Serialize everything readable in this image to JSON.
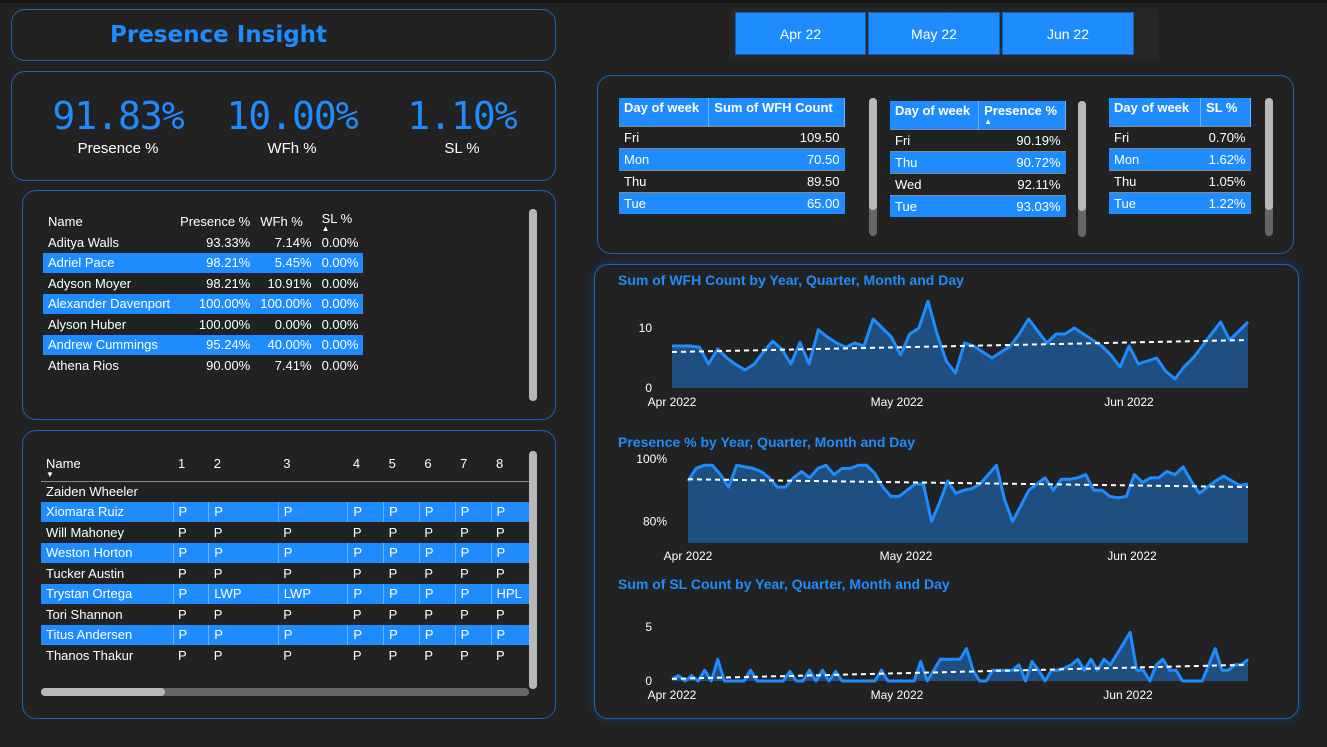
{
  "title": "Presence Insight",
  "slicers": [
    "Apr 22",
    "May 22",
    "Jun 22"
  ],
  "kpis": [
    {
      "value": "91.83%",
      "label": "Presence %"
    },
    {
      "value": "10.00%",
      "label": "WFh %"
    },
    {
      "value": "1.10%",
      "label": "SL %"
    }
  ],
  "summary_table": {
    "headers": [
      "Name",
      "Presence %",
      "WFh %",
      "SL %"
    ],
    "rows": [
      [
        "Aditya Walls",
        "93.33%",
        "7.14%",
        "0.00%"
      ],
      [
        "Adriel Pace",
        "98.21%",
        "5.45%",
        "0.00%"
      ],
      [
        "Adyson Moyer",
        "98.21%",
        "10.91%",
        "0.00%"
      ],
      [
        "Alexander Davenport",
        "100.00%",
        "100.00%",
        "0.00%"
      ],
      [
        "Alyson Huber",
        "100.00%",
        "0.00%",
        "0.00%"
      ],
      [
        "Andrew Cummings",
        "95.24%",
        "40.00%",
        "0.00%"
      ],
      [
        "Athena Rios",
        "90.00%",
        "7.41%",
        "0.00%"
      ]
    ]
  },
  "daily_table": {
    "headers": [
      "Name",
      "1",
      "2",
      "3",
      "4",
      "5",
      "6",
      "7",
      "8"
    ],
    "rows": [
      [
        "Zaiden Wheeler",
        "",
        "",
        "",
        "",
        "",
        "",
        "",
        ""
      ],
      [
        "Xiomara Ruiz",
        "P",
        "P",
        "P",
        "P",
        "P",
        "P",
        "P",
        "P"
      ],
      [
        "Will Mahoney",
        "P",
        "P",
        "P",
        "P",
        "P",
        "P",
        "P",
        "P"
      ],
      [
        "Weston Horton",
        "P",
        "P",
        "P",
        "P",
        "P",
        "P",
        "P",
        "P"
      ],
      [
        "Tucker Austin",
        "P",
        "P",
        "P",
        "P",
        "P",
        "P",
        "P",
        "P"
      ],
      [
        "Trystan Ortega",
        "P",
        "LWP",
        "LWP",
        "P",
        "P",
        "P",
        "P",
        "HPL"
      ],
      [
        "Tori Shannon",
        "P",
        "P",
        "P",
        "P",
        "P",
        "P",
        "P",
        "P"
      ],
      [
        "Titus Andersen",
        "P",
        "P",
        "P",
        "P",
        "P",
        "P",
        "P",
        "P"
      ],
      [
        "Thanos Thakur",
        "P",
        "P",
        "P",
        "P",
        "P",
        "P",
        "P",
        "P"
      ]
    ]
  },
  "wfh_by_day": {
    "headers": [
      "Day of week",
      "Sum of WFH Count"
    ],
    "rows": [
      [
        "Fri",
        "109.50"
      ],
      [
        "Mon",
        "70.50"
      ],
      [
        "Thu",
        "89.50"
      ],
      [
        "Tue",
        "65.00"
      ]
    ]
  },
  "presence_by_day": {
    "headers": [
      "Day of week",
      "Presence %"
    ],
    "rows": [
      [
        "Fri",
        "90.19%"
      ],
      [
        "Thu",
        "90.72%"
      ],
      [
        "Wed",
        "92.11%"
      ],
      [
        "Tue",
        "93.03%"
      ]
    ]
  },
  "sl_by_day": {
    "headers": [
      "Day of week",
      "SL %"
    ],
    "rows": [
      [
        "Fri",
        "0.70%"
      ],
      [
        "Mon",
        "1.62%"
      ],
      [
        "Thu",
        "1.05%"
      ],
      [
        "Tue",
        "1.22%"
      ]
    ]
  },
  "colors": {
    "accent": "#1e8cff",
    "area": "#1f4e80",
    "background": "#222222",
    "border": "#1c64b8"
  },
  "chart_data": [
    {
      "type": "area",
      "title": "Sum of WFH Count by Year, Quarter, Month and Day",
      "ylim": [
        0,
        15
      ],
      "y_ticks": [
        "0",
        "10"
      ],
      "y_tick_values": [
        0,
        10
      ],
      "x_ticks": [
        "Apr 2022",
        "May 2022",
        "Jun 2022"
      ],
      "trend_line": [
        6,
        8
      ],
      "values": [
        7,
        7,
        7,
        6.8,
        4,
        6.5,
        5,
        3.9,
        3,
        4,
        6,
        7.8,
        6.5,
        4,
        7.6,
        4,
        9.7,
        8.5,
        7.5,
        6.8,
        7.5,
        7,
        11.5,
        10,
        8.5,
        5.5,
        9,
        10,
        14.5,
        9,
        4.5,
        2.5,
        7.5,
        7,
        6,
        5,
        6,
        7,
        9,
        11.5,
        9.5,
        7.5,
        9,
        9,
        10,
        9,
        8,
        7,
        5.5,
        3.5,
        7,
        4,
        4.5,
        5,
        2.8,
        1.5,
        3.5,
        5,
        7,
        9,
        11,
        8,
        9.5,
        11
      ]
    },
    {
      "type": "area",
      "title": "Presence % by Year, Quarter, Month and Day",
      "ylim": [
        0.73,
        1.01
      ],
      "y_ticks": [
        "80%",
        "100%"
      ],
      "y_tick_values": [
        0.8,
        1.0
      ],
      "x_ticks": [
        "Apr 2022",
        "May 2022",
        "Jun 2022"
      ],
      "trend_line": [
        0.935,
        0.91
      ],
      "values": [
        0.93,
        0.97,
        0.98,
        0.98,
        0.95,
        0.91,
        0.98,
        0.975,
        0.97,
        0.96,
        0.94,
        0.91,
        0.91,
        0.94,
        0.96,
        0.94,
        0.97,
        0.98,
        0.95,
        0.97,
        0.97,
        0.98,
        0.98,
        0.955,
        0.91,
        0.88,
        0.88,
        0.9,
        0.92,
        0.92,
        0.8,
        0.86,
        0.93,
        0.89,
        0.9,
        0.905,
        0.92,
        0.95,
        0.98,
        0.87,
        0.8,
        0.85,
        0.9,
        0.92,
        0.94,
        0.9,
        0.935,
        0.935,
        0.94,
        0.95,
        0.9,
        0.9,
        0.88,
        0.875,
        0.88,
        0.95,
        0.925,
        0.94,
        0.94,
        0.96,
        0.95,
        0.975,
        0.93,
        0.89,
        0.91,
        0.93,
        0.945,
        0.93,
        0.915,
        0.92
      ]
    },
    {
      "type": "area",
      "title": "Sum of SL Count by Year, Quarter, Month and Day",
      "ylim": [
        0,
        6
      ],
      "y_ticks": [
        "0",
        "5"
      ],
      "y_tick_values": [
        0,
        5
      ],
      "x_ticks": [
        "Apr 2022",
        "May 2022",
        "Jun 2022"
      ],
      "trend_line": [
        0.2,
        1.5
      ],
      "values": [
        0.2,
        0.5,
        0,
        0.5,
        0,
        1,
        0,
        2,
        0,
        0,
        0,
        0,
        1,
        0,
        0,
        0,
        0,
        0,
        0.9,
        0,
        0,
        1,
        0,
        1,
        0,
        0.9,
        0,
        0,
        0,
        0,
        0,
        0,
        1,
        0,
        0,
        0,
        0,
        0,
        1.8,
        0,
        1,
        2,
        2,
        2,
        2,
        3,
        1,
        0,
        0,
        1,
        1,
        1,
        1,
        1.5,
        0,
        1.8,
        1,
        0,
        1,
        1,
        1.2,
        1.5,
        2,
        1,
        2,
        1,
        2,
        1.5,
        2.5,
        3.5,
        4.5,
        1,
        1,
        0,
        1.5,
        2,
        1,
        1,
        0,
        0,
        0,
        0,
        1.5,
        3,
        1,
        1,
        1.5,
        1.5,
        2
      ]
    }
  ]
}
